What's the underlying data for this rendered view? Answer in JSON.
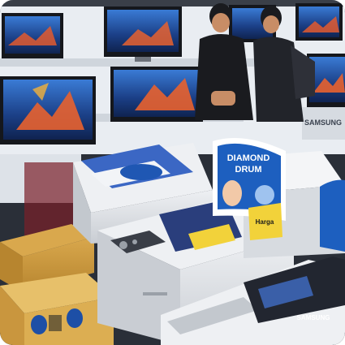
{
  "scene": {
    "signage": {
      "samsung_wordmark": "SAMSUNG",
      "promo_card_line1": "DIAMOND",
      "promo_card_line2": "DRUM",
      "price_tag": "Harga"
    }
  },
  "colors": {
    "ceiling": "#e9edf2",
    "shelf": "#d8dde3",
    "washer_body": "#e3e6ea",
    "washer_shadow": "#b9bec5",
    "panel_dark": "#2b2f38",
    "carton": "#c9963e",
    "carton_dark": "#a87a2c",
    "tv_screen_blue": "#1f4e9c",
    "tv_frame": "#15171c",
    "shirt": "#1a1b1f",
    "skin": "#c88d66",
    "promo_blue": "#1d5fbf",
    "price_yellow": "#f2d23a",
    "floor": "#8a8f96"
  }
}
